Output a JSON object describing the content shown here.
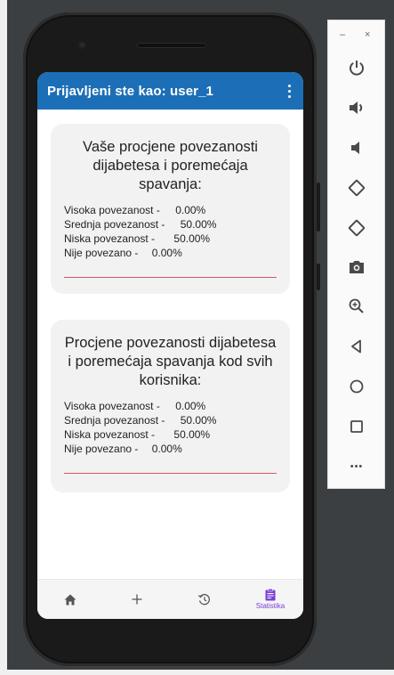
{
  "app": {
    "title": "Prijavljeni ste kao: user_1"
  },
  "cards": [
    {
      "title": "Vaše procjene povezanosti dijabetesa i poremećaja spavanja:",
      "rows": [
        {
          "label": "Visoka povezanost -",
          "value": "0.00%"
        },
        {
          "label": "Srednja povezanost -",
          "value": "50.00%"
        },
        {
          "label": "Niska povezanost -",
          "value": "50.00%"
        },
        {
          "label": "Nije povezano -",
          "value": "0.00%"
        }
      ]
    },
    {
      "title": "Procjene povezanosti dijabetesa i poremećaja spavanja kod svih korisnika:",
      "rows": [
        {
          "label": "Visoka povezanost -",
          "value": "0.00%"
        },
        {
          "label": "Srednja povezanost -",
          "value": "50.00%"
        },
        {
          "label": "Niska povezanost -",
          "value": "50.00%"
        },
        {
          "label": "Nije povezano -",
          "value": "0.00%"
        }
      ]
    }
  ],
  "bottom_nav": {
    "active_label": "Statistika",
    "items": [
      {
        "icon": "home-icon"
      },
      {
        "icon": "plus-icon"
      },
      {
        "icon": "history-icon"
      },
      {
        "icon": "clipboard-icon",
        "label": "Statistika",
        "active": true
      }
    ]
  },
  "emulator_toolbar": {
    "minimize": "–",
    "close": "×",
    "buttons": [
      "power-icon",
      "volume-up-icon",
      "volume-down-icon",
      "rotate-left-icon",
      "rotate-right-icon",
      "camera-icon",
      "zoom-icon",
      "back-icon",
      "home-circle-icon",
      "overview-icon",
      "more-icon"
    ],
    "more": "•••"
  },
  "colors": {
    "appbar": "#1c6fb6",
    "accent": "#7b3fd6",
    "divider": "#d5556a",
    "card": "#f2f2f2",
    "toolbar_icon": "#4a4a4a"
  }
}
